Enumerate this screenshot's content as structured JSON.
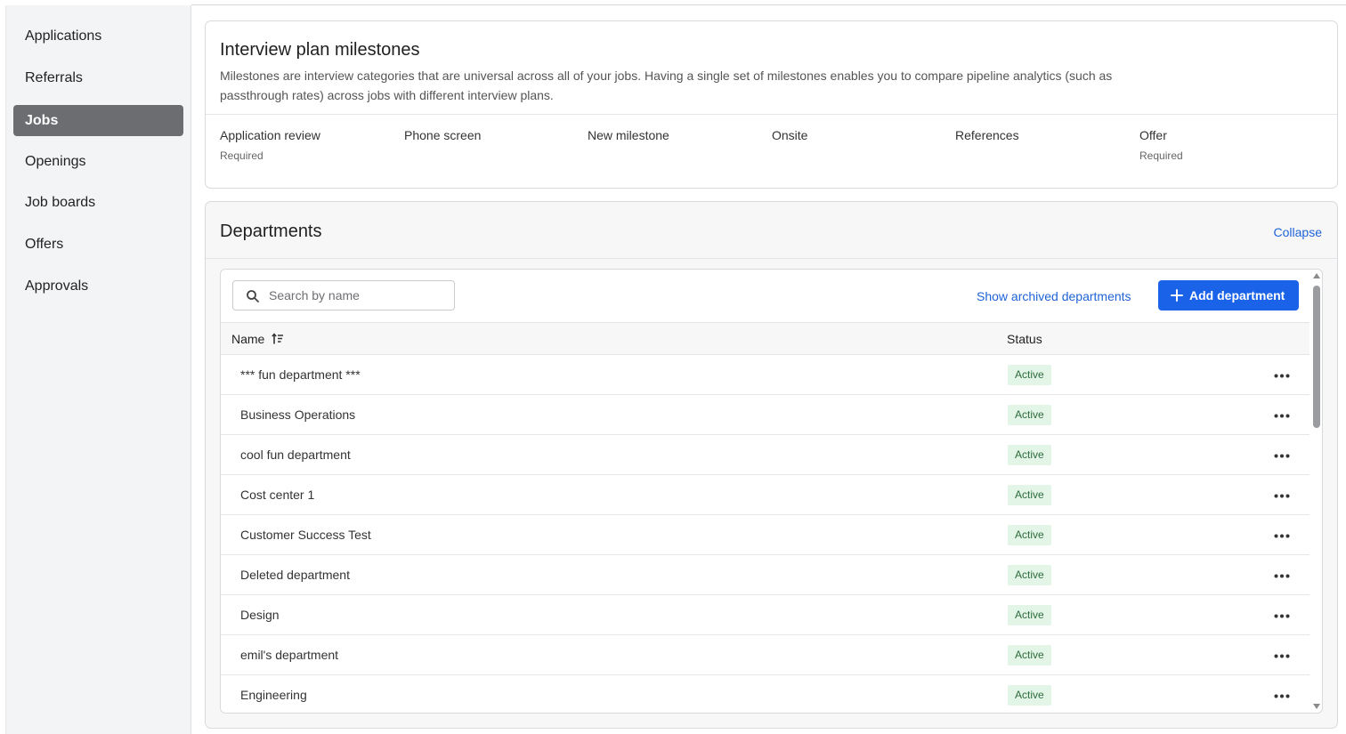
{
  "sidebar": {
    "items": [
      {
        "label": "Applications",
        "active": false
      },
      {
        "label": "Referrals",
        "active": false
      },
      {
        "label": "Jobs",
        "active": true
      },
      {
        "label": "Openings",
        "active": false
      },
      {
        "label": "Job boards",
        "active": false
      },
      {
        "label": "Offers",
        "active": false
      },
      {
        "label": "Approvals",
        "active": false
      }
    ]
  },
  "milestones": {
    "title": "Interview plan milestones",
    "description": "Milestones are interview categories that are universal across all of your jobs. Having a single set of milestones enables you to compare pipeline analytics (such as passthrough rates) across jobs with different interview plans.",
    "items": [
      {
        "name": "Application review",
        "note": "Required"
      },
      {
        "name": "Phone screen",
        "note": ""
      },
      {
        "name": "New milestone",
        "note": ""
      },
      {
        "name": "Onsite",
        "note": ""
      },
      {
        "name": "References",
        "note": ""
      },
      {
        "name": "Offer",
        "note": "Required"
      }
    ]
  },
  "departments": {
    "title": "Departments",
    "collapse_label": "Collapse",
    "search_placeholder": "Search by name",
    "archived_link": "Show archived departments",
    "add_button": "Add department",
    "columns": {
      "name": "Name",
      "status": "Status"
    },
    "rows": [
      {
        "name": "*** fun department ***",
        "status": "Active"
      },
      {
        "name": "Business Operations",
        "status": "Active"
      },
      {
        "name": "cool fun department",
        "status": "Active"
      },
      {
        "name": "Cost center 1",
        "status": "Active"
      },
      {
        "name": "Customer Success Test",
        "status": "Active"
      },
      {
        "name": "Deleted department",
        "status": "Active"
      },
      {
        "name": "Design",
        "status": "Active"
      },
      {
        "name": "emil's department",
        "status": "Active"
      },
      {
        "name": "Engineering",
        "status": "Active"
      }
    ]
  },
  "colors": {
    "accent": "#1a63e8",
    "link": "#1f63d6",
    "active_nav": "#6b6d70",
    "badge_bg": "#e3f5e7",
    "badge_text": "#2d6b3b"
  },
  "icons": {
    "search": "search-icon",
    "add": "plus-icon",
    "sort": "sort-icon",
    "row_menu": "more-horizontal-icon"
  }
}
